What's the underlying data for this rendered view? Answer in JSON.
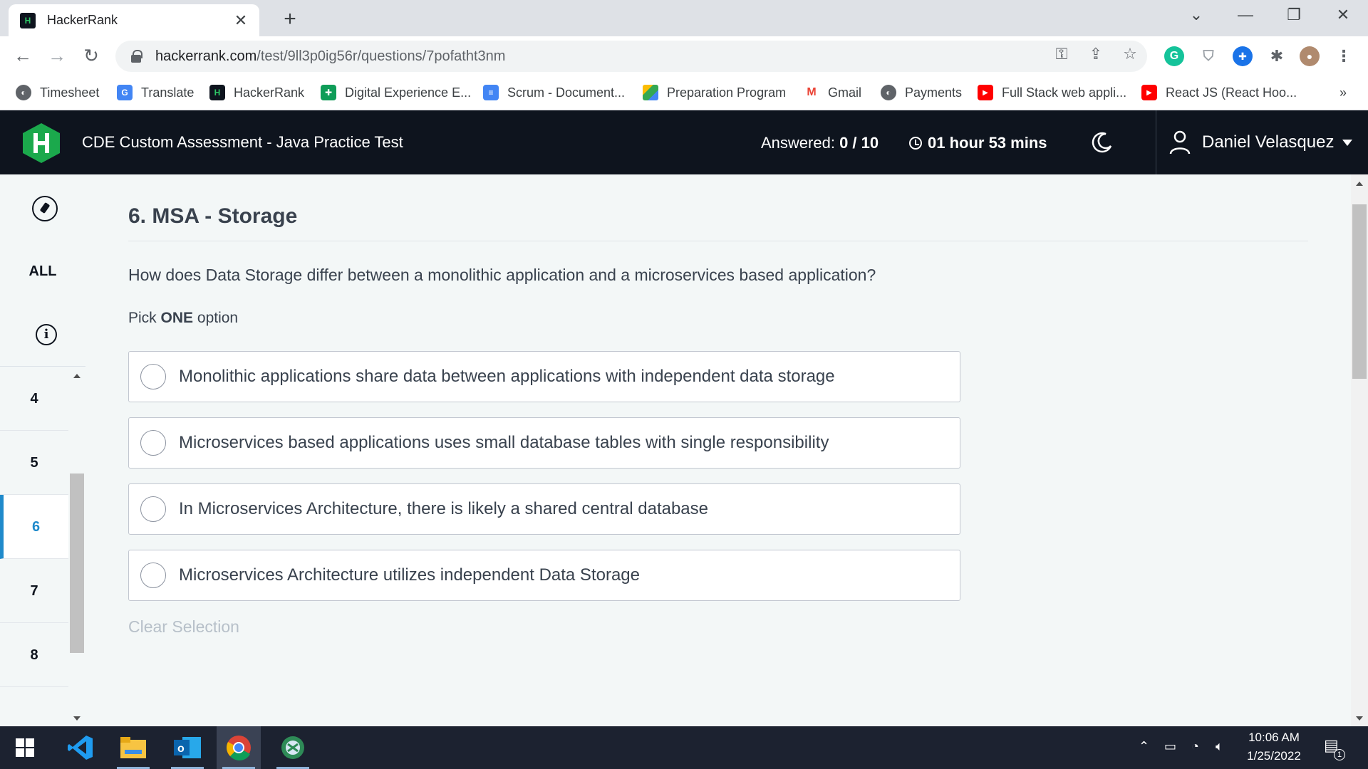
{
  "browser": {
    "tab_title": "HackerRank",
    "tab_favicon": "hackerrank-icon",
    "url_domain": "hackerrank.com",
    "url_path": "/test/9ll3p0ig56r/questions/7pofatht3nm",
    "bookmarks": [
      {
        "label": "Timesheet",
        "icon": "globe-icon"
      },
      {
        "label": "Translate",
        "icon": "google-translate-icon"
      },
      {
        "label": "HackerRank",
        "icon": "hackerrank-icon"
      },
      {
        "label": "Digital Experience E...",
        "icon": "google-sheets-icon"
      },
      {
        "label": "Scrum - Document...",
        "icon": "google-docs-icon"
      },
      {
        "label": "Preparation Program",
        "icon": "google-drive-icon"
      },
      {
        "label": "Gmail",
        "icon": "gmail-icon"
      },
      {
        "label": "Payments",
        "icon": "globe-icon"
      },
      {
        "label": "Full Stack web appli...",
        "icon": "youtube-icon"
      },
      {
        "label": "React JS (React Hoo...",
        "icon": "youtube-icon"
      }
    ],
    "bookmarks_overflow": "»"
  },
  "header": {
    "title": "CDE Custom Assessment - Java Practice Test",
    "answered_label": "Answered:",
    "answered_value": "0 / 10",
    "timer": "01 hour 53 mins",
    "user_name": "Daniel Velasquez"
  },
  "sidebar": {
    "all_label": "ALL",
    "questions": [
      "4",
      "5",
      "6",
      "7",
      "8"
    ],
    "active_question": "6"
  },
  "question": {
    "title": "6. MSA - Storage",
    "text": "How does Data Storage differ between a monolithic application and a microservices based application?",
    "pick_prefix": "Pick",
    "pick_count": "ONE",
    "pick_suffix": "option",
    "options": [
      "Monolithic applications share data between applications with independent data storage",
      "Microservices based applications uses small database tables with single responsibility",
      "In Microservices Architecture, there is likely a shared central database",
      "Microservices Architecture utilizes independent Data Storage"
    ],
    "clear_label": "Clear Selection"
  },
  "taskbar": {
    "apps": [
      "windows-start-icon",
      "vscode-icon",
      "file-explorer-icon",
      "outlook-icon",
      "chrome-icon",
      "xbox-app-icon"
    ],
    "time": "10:06 AM",
    "date": "1/25/2022",
    "notification_count": "1"
  },
  "colors": {
    "header_bg": "#0e141e",
    "brand_green": "#1ba94c",
    "active_blue": "#1f8acb",
    "page_bg": "#f3f7f7"
  }
}
